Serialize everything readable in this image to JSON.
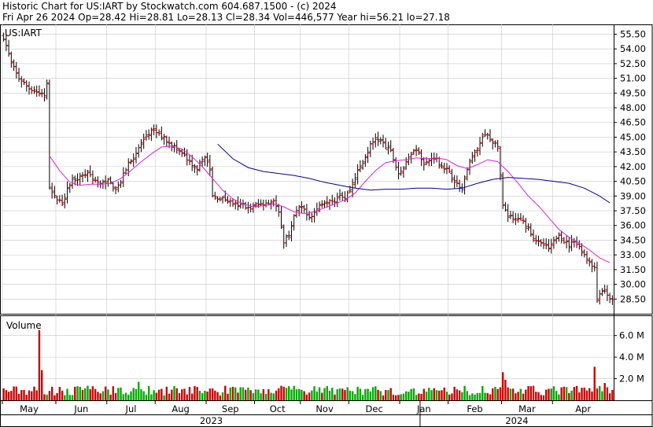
{
  "header": {
    "line1": "Historic Chart for US:IART by Stockwatch.com 604.687.1500 - (c) 2024",
    "line2": "Fri Apr 26 2024   Op=28.42   Hi=28.81   Lo=28.13   Cl=28.34   Vol=446,577   Year hi=56.21   lo=27.18"
  },
  "chart_data": {
    "type": "ohlc",
    "symbol_label": "US:IART",
    "volume_label": "Volume",
    "price_ticks": [
      "55.50",
      "54.00",
      "52.50",
      "51.00",
      "49.50",
      "48.00",
      "46.50",
      "45.00",
      "43.50",
      "42.00",
      "40.50",
      "39.00",
      "37.50",
      "36.00",
      "34.50",
      "33.00",
      "31.50",
      "30.00",
      "28.50"
    ],
    "volume_ticks": [
      "6.0 M",
      "4.0 M",
      "2.0 M"
    ],
    "months": [
      "May",
      "Jun",
      "Jul",
      "Aug",
      "Sep",
      "Oct",
      "Nov",
      "Dec",
      "Jan",
      "Feb",
      "Mar",
      "Apr"
    ],
    "years": [
      "2023",
      "2024"
    ],
    "ylim": [
      27.0,
      56.5
    ],
    "vol_ylim": [
      0,
      7.8
    ],
    "grid": true,
    "colors": {
      "bar": "#000000",
      "tick": "#cc0000",
      "ma_short": "#dd22dd",
      "ma_long": "#000099",
      "vol_up": "#00aa00",
      "vol_down": "#cc0000",
      "grid": "#c8c8c8"
    },
    "close_path": [
      [
        0,
        55.2
      ],
      [
        3,
        52.5
      ],
      [
        6,
        51.0
      ],
      [
        10,
        50.0
      ],
      [
        13,
        49.6
      ],
      [
        16,
        49.3
      ],
      [
        17,
        50.4
      ],
      [
        18,
        39.7
      ],
      [
        20,
        38.9
      ],
      [
        23,
        38.3
      ],
      [
        25,
        39.7
      ],
      [
        27,
        40.6
      ],
      [
        30,
        41.0
      ],
      [
        33,
        41.4
      ],
      [
        36,
        40.6
      ],
      [
        38,
        40.2
      ],
      [
        41,
        40.6
      ],
      [
        44,
        39.8
      ],
      [
        46,
        40.5
      ],
      [
        49,
        42.4
      ],
      [
        51,
        42.9
      ],
      [
        53,
        43.9
      ],
      [
        56,
        45.1
      ],
      [
        58,
        45.6
      ],
      [
        60,
        45.5
      ],
      [
        63,
        44.9
      ],
      [
        65,
        44.5
      ],
      [
        68,
        43.8
      ],
      [
        70,
        43.4
      ],
      [
        72,
        42.7
      ],
      [
        74,
        42.0
      ],
      [
        76,
        41.9
      ],
      [
        79,
        43.1
      ],
      [
        81,
        41.6
      ],
      [
        82,
        39.0
      ],
      [
        84,
        38.8
      ],
      [
        86,
        38.7
      ],
      [
        89,
        38.4
      ],
      [
        92,
        37.9
      ],
      [
        94,
        38.2
      ],
      [
        96,
        37.7
      ],
      [
        99,
        38.0
      ],
      [
        101,
        38.2
      ],
      [
        104,
        38.4
      ],
      [
        106,
        38.6
      ],
      [
        108,
        37.2
      ],
      [
        110,
        34.4
      ],
      [
        112,
        35.1
      ],
      [
        114,
        36.9
      ],
      [
        116,
        37.9
      ],
      [
        118,
        37.6
      ],
      [
        120,
        36.9
      ],
      [
        122,
        37.3
      ],
      [
        124,
        38.1
      ],
      [
        126,
        38.4
      ],
      [
        128,
        38.7
      ],
      [
        130,
        38.6
      ],
      [
        132,
        39.2
      ],
      [
        134,
        38.8
      ],
      [
        136,
        39.7
      ],
      [
        138,
        41.0
      ],
      [
        140,
        42.0
      ],
      [
        142,
        43.0
      ],
      [
        144,
        44.2
      ],
      [
        146,
        44.8
      ],
      [
        148,
        44.6
      ],
      [
        150,
        44.0
      ],
      [
        152,
        43.5
      ],
      [
        155,
        41.3
      ],
      [
        157,
        41.8
      ],
      [
        159,
        42.9
      ],
      [
        161,
        43.8
      ],
      [
        163,
        43.6
      ],
      [
        165,
        42.2
      ],
      [
        167,
        42.6
      ],
      [
        169,
        43.0
      ],
      [
        172,
        42.1
      ],
      [
        174,
        41.7
      ],
      [
        176,
        41.0
      ],
      [
        178,
        40.2
      ],
      [
        180,
        39.8
      ],
      [
        182,
        41.8
      ],
      [
        184,
        43.0
      ],
      [
        186,
        43.8
      ],
      [
        188,
        45.0
      ],
      [
        190,
        45.2
      ],
      [
        192,
        44.5
      ],
      [
        194,
        44.2
      ],
      [
        195,
        41.0
      ],
      [
        196,
        38.0
      ],
      [
        198,
        37.0
      ],
      [
        200,
        36.6
      ],
      [
        202,
        36.7
      ],
      [
        204,
        36.4
      ],
      [
        206,
        35.8
      ],
      [
        208,
        34.8
      ],
      [
        210,
        34.2
      ],
      [
        212,
        34.0
      ],
      [
        214,
        33.6
      ],
      [
        216,
        34.3
      ],
      [
        218,
        35.3
      ],
      [
        220,
        34.4
      ],
      [
        222,
        34.0
      ],
      [
        224,
        34.5
      ],
      [
        226,
        33.8
      ],
      [
        228,
        33.0
      ],
      [
        230,
        32.3
      ],
      [
        232,
        31.7
      ],
      [
        233,
        28.7
      ],
      [
        235,
        29.4
      ],
      [
        237,
        29.0
      ],
      [
        238,
        28.34
      ]
    ],
    "ma_short_path": [
      [
        18,
        43.1
      ],
      [
        22,
        41.6
      ],
      [
        26,
        40.4
      ],
      [
        30,
        40.1
      ],
      [
        34,
        40.2
      ],
      [
        38,
        40.2
      ],
      [
        42,
        40.3
      ],
      [
        46,
        40.8
      ],
      [
        50,
        41.6
      ],
      [
        54,
        42.5
      ],
      [
        58,
        43.3
      ],
      [
        62,
        44.0
      ],
      [
        66,
        44.1
      ],
      [
        70,
        43.8
      ],
      [
        74,
        43.0
      ],
      [
        78,
        42.0
      ],
      [
        82,
        40.8
      ],
      [
        86,
        39.6
      ],
      [
        90,
        38.7
      ],
      [
        94,
        38.2
      ],
      [
        98,
        37.9
      ],
      [
        102,
        38.0
      ],
      [
        106,
        38.2
      ],
      [
        110,
        37.9
      ],
      [
        114,
        37.4
      ],
      [
        118,
        37.2
      ],
      [
        122,
        37.4
      ],
      [
        126,
        37.8
      ],
      [
        130,
        38.2
      ],
      [
        134,
        38.6
      ],
      [
        138,
        39.3
      ],
      [
        142,
        40.5
      ],
      [
        146,
        41.6
      ],
      [
        150,
        42.4
      ],
      [
        154,
        42.6
      ],
      [
        158,
        42.7
      ],
      [
        162,
        42.9
      ],
      [
        166,
        42.8
      ],
      [
        170,
        42.9
      ],
      [
        174,
        42.7
      ],
      [
        178,
        42.1
      ],
      [
        182,
        41.8
      ],
      [
        186,
        42.2
      ],
      [
        190,
        42.7
      ],
      [
        194,
        42.5
      ],
      [
        198,
        41.5
      ],
      [
        202,
        40.3
      ],
      [
        206,
        39.0
      ],
      [
        210,
        38.0
      ],
      [
        214,
        36.8
      ],
      [
        218,
        35.6
      ],
      [
        222,
        34.8
      ],
      [
        226,
        34.2
      ],
      [
        230,
        33.5
      ],
      [
        234,
        32.7
      ],
      [
        238,
        32.2
      ]
    ],
    "ma_long_path": [
      [
        84,
        44.3
      ],
      [
        90,
        42.8
      ],
      [
        96,
        41.9
      ],
      [
        102,
        41.5
      ],
      [
        108,
        41.3
      ],
      [
        114,
        41.1
      ],
      [
        120,
        40.8
      ],
      [
        126,
        40.4
      ],
      [
        132,
        40.1
      ],
      [
        138,
        39.8
      ],
      [
        144,
        39.6
      ],
      [
        150,
        39.7
      ],
      [
        156,
        39.7
      ],
      [
        162,
        39.8
      ],
      [
        168,
        39.8
      ],
      [
        174,
        39.7
      ],
      [
        180,
        39.8
      ],
      [
        186,
        40.3
      ],
      [
        192,
        40.7
      ],
      [
        198,
        40.9
      ],
      [
        204,
        40.8
      ],
      [
        210,
        40.7
      ],
      [
        216,
        40.5
      ],
      [
        222,
        40.3
      ],
      [
        228,
        39.8
      ],
      [
        234,
        39.0
      ],
      [
        238,
        38.3
      ]
    ],
    "volume_spikes": [
      [
        14,
        6.5
      ],
      [
        15,
        2.8
      ],
      [
        53,
        1.7
      ],
      [
        196,
        2.6
      ],
      [
        197,
        1.9
      ],
      [
        232,
        3.1
      ],
      [
        236,
        1.6
      ]
    ]
  }
}
